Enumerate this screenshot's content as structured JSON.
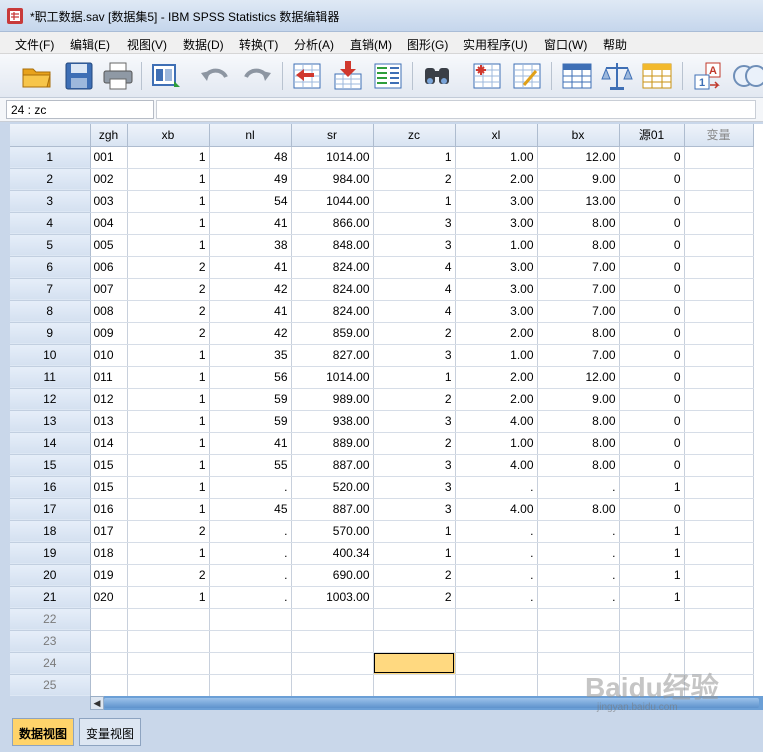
{
  "window": {
    "title": "*职工数据.sav [数据集5] - IBM SPSS Statistics 数据编辑器"
  },
  "menu": [
    {
      "label": "文件(F)"
    },
    {
      "label": "编辑(E)"
    },
    {
      "label": "视图(V)"
    },
    {
      "label": "数据(D)"
    },
    {
      "label": "转换(T)"
    },
    {
      "label": "分析(A)"
    },
    {
      "label": "直销(M)"
    },
    {
      "label": "图形(G)"
    },
    {
      "label": "实用程序(U)"
    },
    {
      "label": "窗口(W)"
    },
    {
      "label": "帮助"
    }
  ],
  "toolbar": {
    "icons": [
      "open-folder-icon",
      "save-icon",
      "print-icon",
      "recall-dialog-icon",
      "undo-icon",
      "redo-icon",
      "goto-case-icon",
      "goto-variable-icon",
      "variables-icon",
      "find-icon",
      "insert-cases-icon",
      "insert-variable-icon",
      "split-file-icon",
      "weight-cases-icon",
      "select-cases-icon",
      "value-labels-icon",
      "use-sets-icon"
    ],
    "value_labels_badge": "A",
    "value_labels_number": "1"
  },
  "cell_ref": {
    "label": "24 : zc",
    "value": ""
  },
  "grid": {
    "columns": [
      "zgh",
      "xb",
      "nl",
      "sr",
      "zc",
      "xl",
      "bx",
      "源01",
      "变量"
    ],
    "rows": [
      {
        "n": "1",
        "cells": [
          "001",
          "1",
          "48",
          "1014.00",
          "1",
          "1.00",
          "12.00",
          "0"
        ]
      },
      {
        "n": "2",
        "cells": [
          "002",
          "1",
          "49",
          "984.00",
          "2",
          "2.00",
          "9.00",
          "0"
        ]
      },
      {
        "n": "3",
        "cells": [
          "003",
          "1",
          "54",
          "1044.00",
          "1",
          "3.00",
          "13.00",
          "0"
        ]
      },
      {
        "n": "4",
        "cells": [
          "004",
          "1",
          "41",
          "866.00",
          "3",
          "3.00",
          "8.00",
          "0"
        ]
      },
      {
        "n": "5",
        "cells": [
          "005",
          "1",
          "38",
          "848.00",
          "3",
          "1.00",
          "8.00",
          "0"
        ]
      },
      {
        "n": "6",
        "cells": [
          "006",
          "2",
          "41",
          "824.00",
          "4",
          "3.00",
          "7.00",
          "0"
        ]
      },
      {
        "n": "7",
        "cells": [
          "007",
          "2",
          "42",
          "824.00",
          "4",
          "3.00",
          "7.00",
          "0"
        ]
      },
      {
        "n": "8",
        "cells": [
          "008",
          "2",
          "41",
          "824.00",
          "4",
          "3.00",
          "7.00",
          "0"
        ]
      },
      {
        "n": "9",
        "cells": [
          "009",
          "2",
          "42",
          "859.00",
          "2",
          "2.00",
          "8.00",
          "0"
        ]
      },
      {
        "n": "10",
        "cells": [
          "010",
          "1",
          "35",
          "827.00",
          "3",
          "1.00",
          "7.00",
          "0"
        ]
      },
      {
        "n": "11",
        "cells": [
          "011",
          "1",
          "56",
          "1014.00",
          "1",
          "2.00",
          "12.00",
          "0"
        ]
      },
      {
        "n": "12",
        "cells": [
          "012",
          "1",
          "59",
          "989.00",
          "2",
          "2.00",
          "9.00",
          "0"
        ]
      },
      {
        "n": "13",
        "cells": [
          "013",
          "1",
          "59",
          "938.00",
          "3",
          "4.00",
          "8.00",
          "0"
        ]
      },
      {
        "n": "14",
        "cells": [
          "014",
          "1",
          "41",
          "889.00",
          "2",
          "1.00",
          "8.00",
          "0"
        ]
      },
      {
        "n": "15",
        "cells": [
          "015",
          "1",
          "55",
          "887.00",
          "3",
          "4.00",
          "8.00",
          "0"
        ]
      },
      {
        "n": "16",
        "cells": [
          "015",
          "1",
          ".",
          "520.00",
          "3",
          ".",
          ".",
          "1"
        ]
      },
      {
        "n": "17",
        "cells": [
          "016",
          "1",
          "45",
          "887.00",
          "3",
          "4.00",
          "8.00",
          "0"
        ]
      },
      {
        "n": "18",
        "cells": [
          "017",
          "2",
          ".",
          "570.00",
          "1",
          ".",
          ".",
          "1"
        ]
      },
      {
        "n": "19",
        "cells": [
          "018",
          "1",
          ".",
          "400.34",
          "1",
          ".",
          ".",
          "1"
        ]
      },
      {
        "n": "20",
        "cells": [
          "019",
          "2",
          ".",
          "690.00",
          "2",
          ".",
          ".",
          "1"
        ]
      },
      {
        "n": "21",
        "cells": [
          "020",
          "1",
          ".",
          "1003.00",
          "2",
          ".",
          ".",
          "1"
        ]
      }
    ],
    "empty_rows": [
      "22",
      "23",
      "24",
      "25"
    ],
    "selected_cell": {
      "row": "24",
      "column": "zc"
    }
  },
  "tabs": {
    "data_view": "数据视图",
    "variable_view": "变量视图"
  },
  "watermark": {
    "text": "Baidu经验",
    "sub": "jingyan.baidu.com"
  }
}
